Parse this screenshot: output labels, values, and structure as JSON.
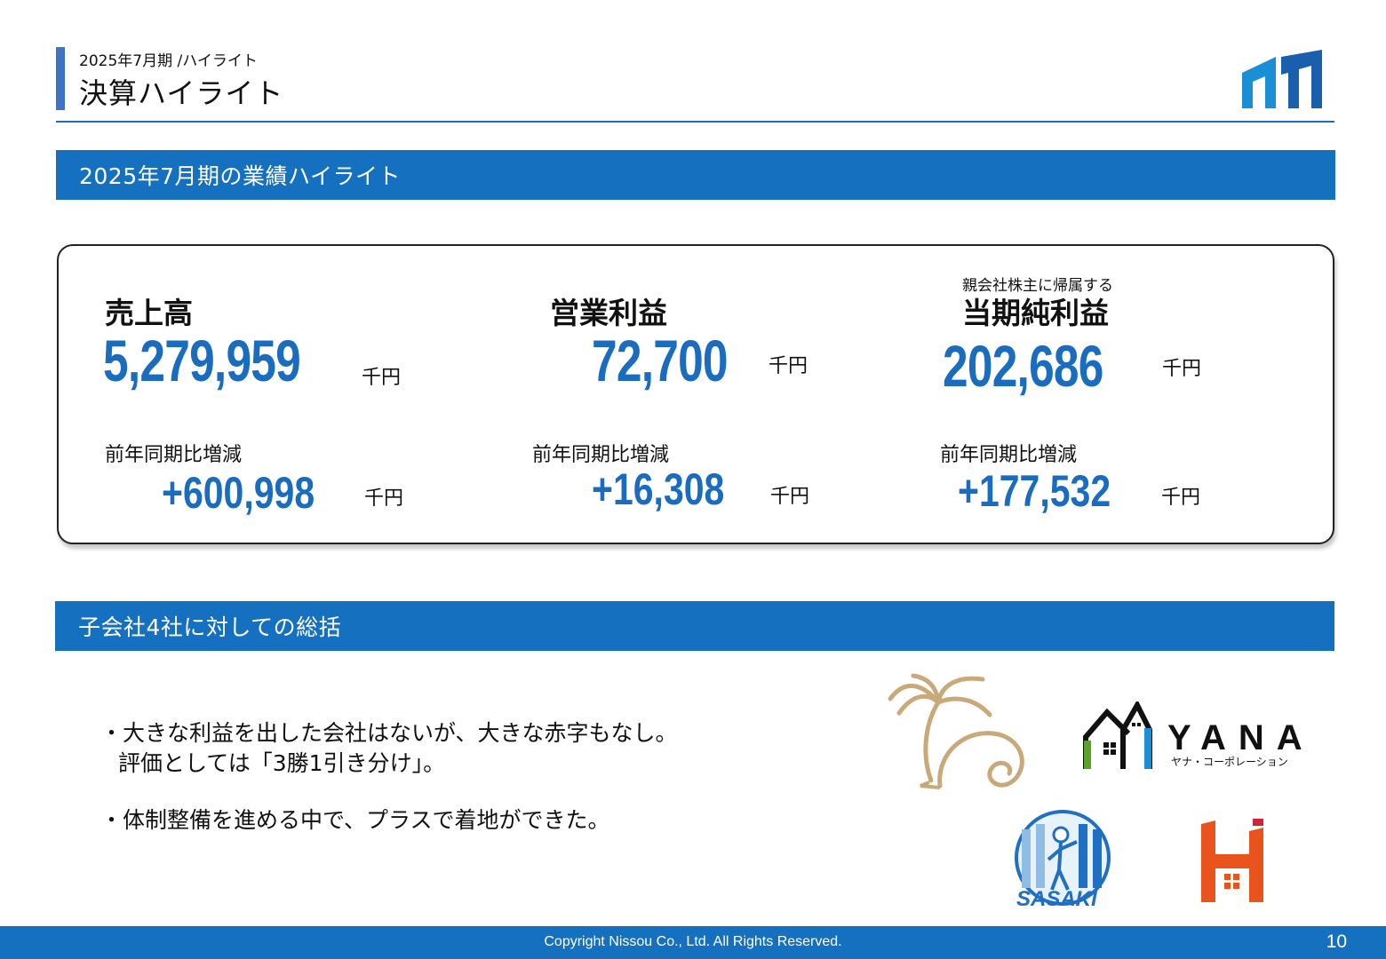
{
  "header": {
    "breadcrumb": "2025年7月期 /ハイライト",
    "title": "決算ハイライト"
  },
  "section1": {
    "title": "2025年7月期の業績ハイライト"
  },
  "kpis": [
    {
      "label": "売上高",
      "value": "5,279,959",
      "unit": "千円",
      "compare_label": "前年同期比増減",
      "diff": "+600,998",
      "diff_unit": "千円"
    },
    {
      "label": "営業利益",
      "value": "72,700",
      "unit": "千円",
      "compare_label": "前年同期比増減",
      "diff": "+16,308",
      "diff_unit": "千円"
    },
    {
      "sublabel": "親会社株主に帰属する",
      "label": "当期純利益",
      "value": "202,686",
      "unit": "千円",
      "compare_label": "前年同期比増減",
      "diff": "+177,532",
      "diff_unit": "千円"
    }
  ],
  "section2": {
    "title": "子会社4社に対しての総括"
  },
  "summary": {
    "bullet1_line1": "・大きな利益を出した会社はないが、大きな赤字もなし。",
    "bullet1_line2": "評価としては「3勝1引き分け」。",
    "bullet2": "・体制整備を進める中で、プラスで着地ができた。"
  },
  "logos": {
    "yana_name": "YANA",
    "yana_sub": "ヤナ・コーポレーション",
    "sasaki_text": "SASAKI"
  },
  "colors": {
    "brand_blue": "#1570bf",
    "value_blue": "#1a6cbf",
    "h_logo_orange": "#e8541c"
  },
  "footer": {
    "copyright": "Copyright Nissou Co., Ltd. All Rights Reserved.",
    "page_number": "10"
  }
}
